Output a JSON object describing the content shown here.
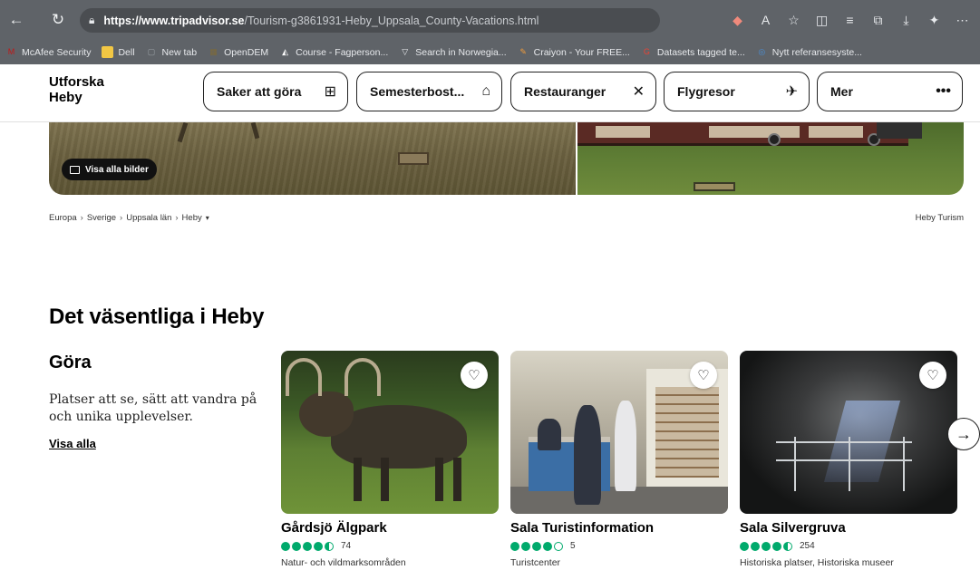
{
  "browser": {
    "url_host": "https://www.tripadvisor.se",
    "url_path": "/Tourism-g3861931-Heby_Uppsala_County-Vacations.html",
    "bookmarks": [
      {
        "label": "McAfee Security",
        "icon": "mcafee-icon",
        "color": "#c01818"
      },
      {
        "label": "Dell",
        "icon": "folder-icon",
        "color": "#f2c744"
      },
      {
        "label": "New tab",
        "icon": "newtab-icon",
        "color": "#9aa0a6"
      },
      {
        "label": "OpenDEM",
        "icon": "opendem-icon",
        "color": "#7d6a3a"
      },
      {
        "label": "Course - Fagperson...",
        "icon": "course-icon",
        "color": "#ffffff"
      },
      {
        "label": "Search in Norwegia...",
        "icon": "triangle-icon",
        "color": "#e8eaed"
      },
      {
        "label": "Craiyon - Your FREE...",
        "icon": "pencil-icon",
        "color": "#f29c3a"
      },
      {
        "label": "Datasets tagged te...",
        "icon": "google-icon",
        "color": "#ea4335"
      },
      {
        "label": "Nytt referansesyste...",
        "icon": "globe-icon",
        "color": "#4a90d9"
      }
    ]
  },
  "header": {
    "brand_line1": "Utforska",
    "brand_line2": "Heby",
    "nav": [
      {
        "label": "Saker att göra",
        "icon": "ticket-icon"
      },
      {
        "label": "Semesterbost...",
        "icon": "house-icon"
      },
      {
        "label": "Restauranger",
        "icon": "cutlery-icon"
      },
      {
        "label": "Flygresor",
        "icon": "plane-icon"
      },
      {
        "label": "Mer",
        "icon": "more-icon"
      }
    ]
  },
  "hero": {
    "show_all_label": "Visa alla bilder"
  },
  "breadcrumb": {
    "items": [
      "Europa",
      "Sverige",
      "Uppsala län",
      "Heby"
    ],
    "right_label": "Heby Turism"
  },
  "section": {
    "title": "Det väsentliga i Heby",
    "category_title": "Göra",
    "category_desc": "Platser att se, sätt att vandra på och unika upplevelser.",
    "category_link": "Visa alla"
  },
  "cards": [
    {
      "name": "Gårdsjö Älgpark",
      "rating": 4.5,
      "reviews": "74",
      "category": "Natur- och vildmarksområden"
    },
    {
      "name": "Sala Turistinformation",
      "rating": 4,
      "reviews": "5",
      "category": "Turistcenter"
    },
    {
      "name": "Sala Silvergruva",
      "rating": 4.5,
      "reviews": "254",
      "category": "Historiska platser, Historiska museer"
    }
  ],
  "colors": {
    "rating_green": "#00aa6c",
    "browser_chrome": "#5f6368"
  }
}
